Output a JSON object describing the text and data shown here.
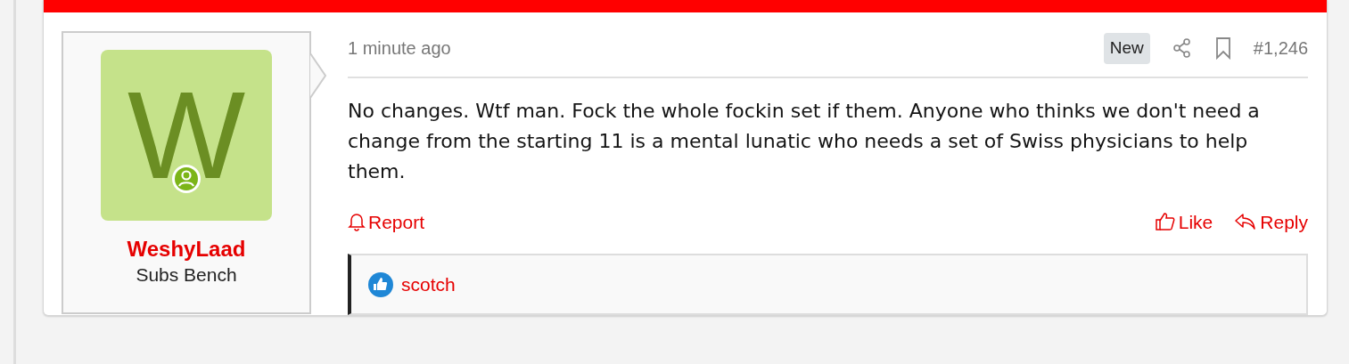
{
  "post": {
    "time": "1 minute ago",
    "badge": "New",
    "number": "#1,246",
    "body": "No changes. Wtf man. Fock the whole fockin set if them. Anyone who thinks we don't need a change from the starting 11 is a mental lunatic who needs a set of Swiss physicians to help them.",
    "actions_left": [
      {
        "label": "Report",
        "kind": "report"
      }
    ],
    "actions_right": [
      {
        "label": "Like",
        "kind": "like"
      },
      {
        "label": "Reply",
        "kind": "reply"
      }
    ],
    "reactions": [
      {
        "user": "scotch"
      }
    ]
  },
  "user": {
    "avatar_letter": "W",
    "online": true,
    "name": "WeshyLaad",
    "title": "Subs Bench"
  }
}
